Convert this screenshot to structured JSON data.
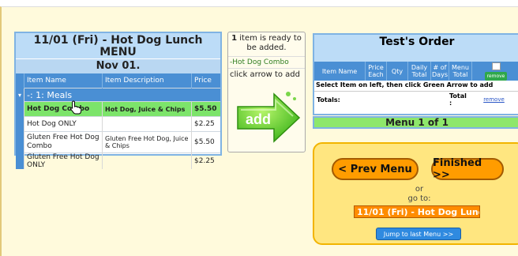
{
  "menu": {
    "title": "11/01 (Fri) - Hot Dog Lunch MENU",
    "date": "Nov 01.",
    "columns": [
      "Item Name",
      "Item Description",
      "Price"
    ],
    "group": "-: 1: Meals",
    "items": [
      {
        "name": "Hot Dog Combo",
        "desc": "Hot Dog, Juice & Chips",
        "price": "$5.50"
      },
      {
        "name": "Hot Dog ONLY",
        "desc": "",
        "price": "$2.25"
      },
      {
        "name": "Gluten Free Hot Dog Combo",
        "desc": "Gluten Free Hot Dog, Juice & Chips",
        "price": "$5.50"
      },
      {
        "name": "Gluten Free Hot Dog ONLY",
        "desc": "",
        "price": "$2.25"
      }
    ]
  },
  "add": {
    "count": "1",
    "ready_text": "item is ready to be added.",
    "item": "-Hot Dog Combo",
    "hint": "click arrow to add",
    "button_label": "add"
  },
  "order": {
    "title": "Test's Order",
    "columns": [
      "Item Name",
      "Price Each",
      "Qty",
      "Daily Total",
      "# of Days",
      "Menu Total",
      "remove"
    ],
    "note": "Select Item on left, then click Green Arrow to add",
    "totals_label": "Totals:",
    "total_label": "Total :",
    "remove_label": "remove",
    "menu_of": "Menu 1 of 1"
  },
  "nav": {
    "prev": "< Prev Menu",
    "finished": "Finished >>",
    "or": "or",
    "goto": "go to:",
    "select_value": "11/01 (Fri) - Hot Dog Lunch",
    "jump": "Jump to last Menu >>"
  }
}
